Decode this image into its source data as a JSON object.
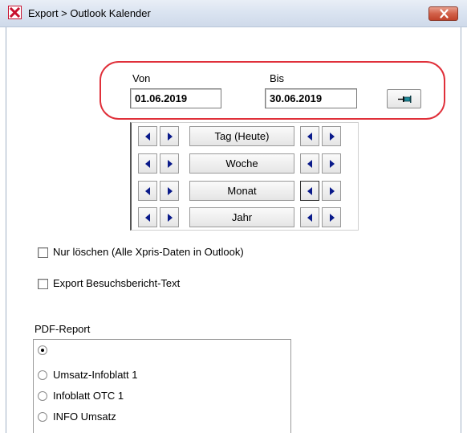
{
  "window": {
    "title": "Export > Outlook Kalender",
    "app_icon": "red-x-icon",
    "close_icon": "close-icon"
  },
  "date_range": {
    "from_label": "Von",
    "from_value": "01.06.2019",
    "to_label": "Bis",
    "to_value": "30.06.2019",
    "apply_icon": "pin-icon"
  },
  "nav_rows": [
    {
      "label": "Tag (Heute)"
    },
    {
      "label": "Woche"
    },
    {
      "label": "Monat"
    },
    {
      "label": "Jahr"
    }
  ],
  "options": {
    "delete_only": {
      "label": "Nur löschen (Alle Xpris-Daten in Outlook)",
      "checked": false
    },
    "export_text": {
      "label": "Export Besuchsbericht-Text",
      "checked": false
    }
  },
  "pdf_report": {
    "label": "PDF-Report",
    "selected_index": 0,
    "options": [
      "",
      "Umsatz-Infoblatt 1",
      "Infoblatt OTC 1",
      "INFO Umsatz"
    ]
  },
  "colors": {
    "highlight": "#e0303a",
    "arrow": "#0a1a8a"
  }
}
